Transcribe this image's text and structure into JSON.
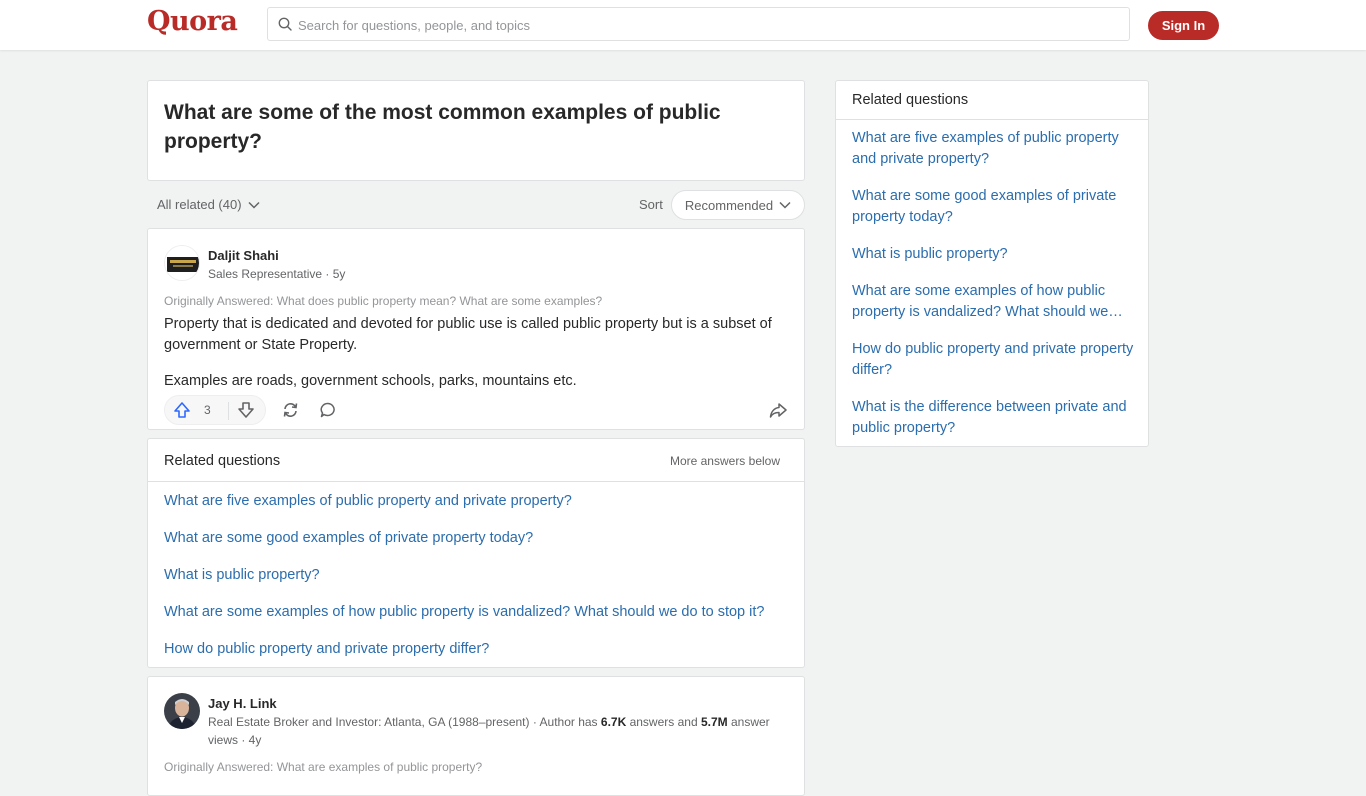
{
  "header": {
    "logo": "Quora",
    "search_placeholder": "Search for questions, people, and topics",
    "signin_label": "Sign In"
  },
  "question": {
    "title": "What are some of the most common examples of public property?"
  },
  "filters": {
    "all_related": "All related (40)",
    "sort_label": "Sort",
    "sort_value": "Recommended"
  },
  "answers": [
    {
      "author": "Daljit Shahi",
      "credential": "Sales Representative · 5y",
      "originally_answered": "Originally Answered: What does public property mean? What are some examples?",
      "paragraphs": [
        "Property that is dedicated and devoted for public use is called public property but is a subset of government or State Property.",
        "Examples are roads, government schools, parks, mountains etc."
      ],
      "upvotes": "3"
    },
    {
      "author": "Jay H. Link",
      "credential_prefix": "Real Estate Broker and Investor: Atlanta, GA (1988–present) · Author has ",
      "answers_count": "6.7K",
      "credential_mid": " answers and ",
      "views_count": "5.7M",
      "credential_suffix": " answer views · 4y",
      "originally_answered": "Originally Answered: What are examples of public property?"
    }
  ],
  "inline_related": {
    "heading": "Related questions",
    "more": "More answers below",
    "items": [
      "What are five examples of public property and private property?",
      "What are some good examples of private property today?",
      "What is public property?",
      "What are some examples of how public property is vandalized? What should we do to stop it?",
      "How do public property and private property differ?"
    ]
  },
  "sidebar": {
    "heading": "Related questions",
    "items": [
      "What are five examples of public property and private property?",
      "What are some good examples of private property today?",
      "What is public property?",
      "What are some examples of how public property is vandalized? What should we…",
      "How do public property and private property differ?",
      "What is the difference between private and public property?"
    ]
  },
  "colors": {
    "brand": "#b92b27",
    "link": "#2b6dad",
    "upvote": "#2e69ff"
  }
}
